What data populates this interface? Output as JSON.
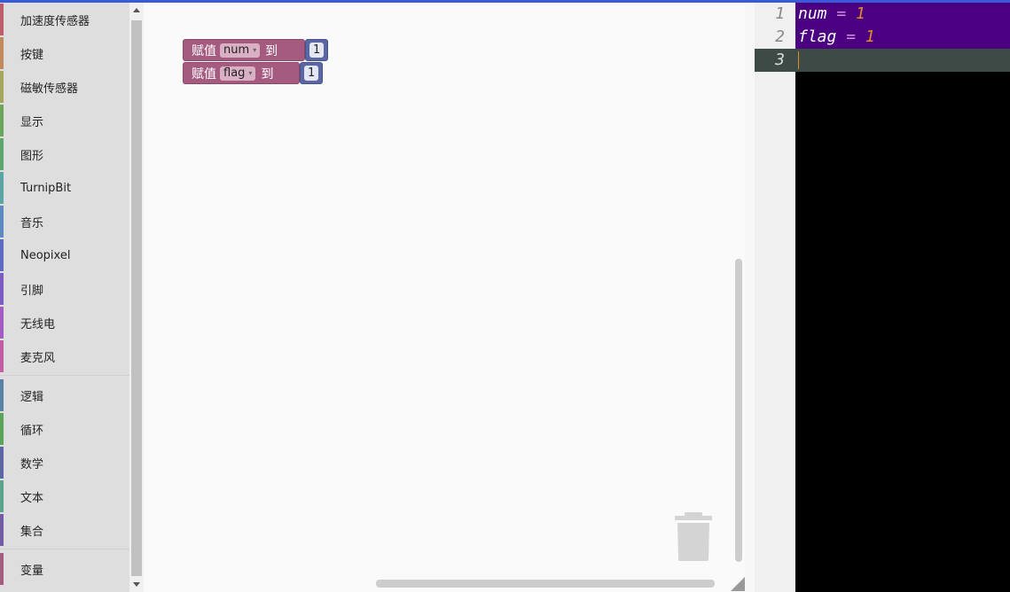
{
  "toolbox": {
    "group1": [
      {
        "label": "加速度传感器",
        "color": "#c05d6c"
      },
      {
        "label": "按键",
        "color": "#c28a5c"
      },
      {
        "label": "磁敏传感器",
        "color": "#a5a55c"
      },
      {
        "label": "显示",
        "color": "#6ca55c"
      },
      {
        "label": "图形",
        "color": "#5ca56c"
      },
      {
        "label": "TurnipBit",
        "color": "#5ca5a5"
      },
      {
        "label": "音乐",
        "color": "#5c8ac2"
      },
      {
        "label": "Neopixel",
        "color": "#5c6cc2"
      },
      {
        "label": "引脚",
        "color": "#7c5cc2"
      },
      {
        "label": "无线电",
        "color": "#a55cc2"
      },
      {
        "label": "麦克风",
        "color": "#c25ca5"
      }
    ],
    "group2": [
      {
        "label": "逻辑",
        "color": "#5b80a5"
      },
      {
        "label": "循环",
        "color": "#5ba55b"
      },
      {
        "label": "数学",
        "color": "#5b67a5"
      },
      {
        "label": "文本",
        "color": "#5ba58c"
      },
      {
        "label": "集合",
        "color": "#745ba5"
      }
    ],
    "group3": [
      {
        "label": "变量",
        "color": "#a55b80"
      }
    ]
  },
  "workspace": {
    "blocks": [
      {
        "keyword": "赋值",
        "variable": "num",
        "to": "到",
        "value": "1"
      },
      {
        "keyword": "赋值",
        "variable": "flag",
        "to": "到",
        "value": "1"
      }
    ]
  },
  "editor": {
    "line_numbers": [
      "1",
      "2",
      "3"
    ],
    "lines": [
      {
        "var": "num",
        "op": "=",
        "num": "1"
      },
      {
        "var": "flag",
        "op": "=",
        "num": "1"
      }
    ]
  }
}
